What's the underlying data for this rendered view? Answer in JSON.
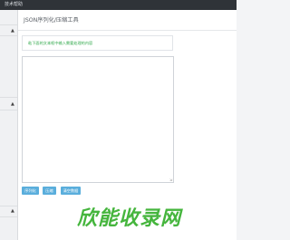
{
  "topbar": {
    "title": "技术帮助"
  },
  "sidebar": {
    "caret_icon": "chevron-up-icon"
  },
  "main": {
    "title": "JSON序列化/压缩工具",
    "tip": "粘下面的文本框中输入需要处理的内容",
    "editor": {
      "value": "",
      "placeholder": ""
    },
    "buttons": [
      {
        "label": "序列化"
      },
      {
        "label": "压缩"
      },
      {
        "label": "清空数据"
      }
    ]
  },
  "watermark": {
    "text": "欣能收录网",
    "color": "#45b53d"
  }
}
